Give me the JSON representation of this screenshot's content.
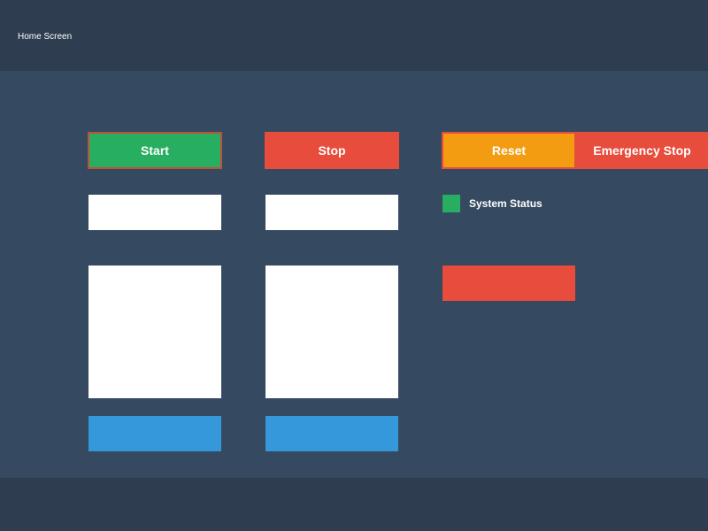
{
  "header": {
    "title": "Home Screen"
  },
  "controls": {
    "start_label": "Start",
    "stop_label": "Stop",
    "reset_label": "Reset",
    "emergency_stop_label": "Emergency Stop"
  },
  "status": {
    "label": "System Status",
    "indicator_color": "#27ae60"
  },
  "colors": {
    "header_bg": "#2e3d50",
    "main_bg": "#354a60",
    "start": "#27ae60",
    "stop": "#e74c3c",
    "reset": "#f39c12",
    "emergency": "#e74c3c",
    "blue_button": "#3498db",
    "alarm": "#e74c3c"
  }
}
